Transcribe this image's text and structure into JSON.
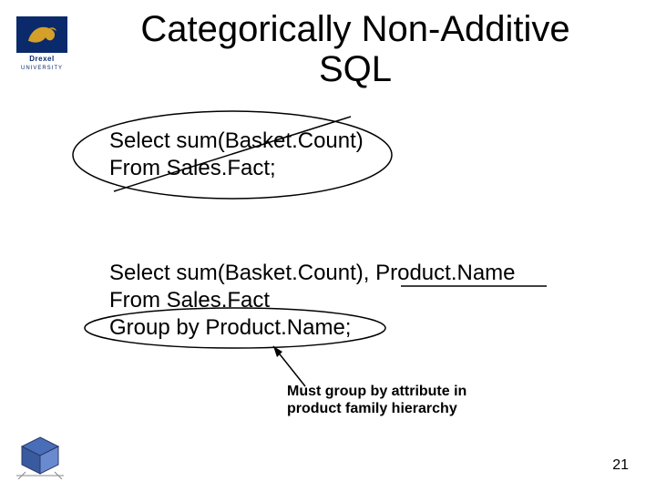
{
  "logo": {
    "university": "UNIVERSITY",
    "name": "Drexel"
  },
  "title": "Categorically Non-Additive SQL",
  "sql1": {
    "line1": "Select sum(Basket.Count)",
    "line2": "From Sales.Fact;"
  },
  "sql2": {
    "line1": "Select sum(Basket.Count), Product.Name",
    "line2": "From Sales.Fact",
    "line3": "Group by Product.Name;"
  },
  "annotation": {
    "line1": "Must group by attribute in",
    "line2": "product family hierarchy"
  },
  "page_number": "21"
}
